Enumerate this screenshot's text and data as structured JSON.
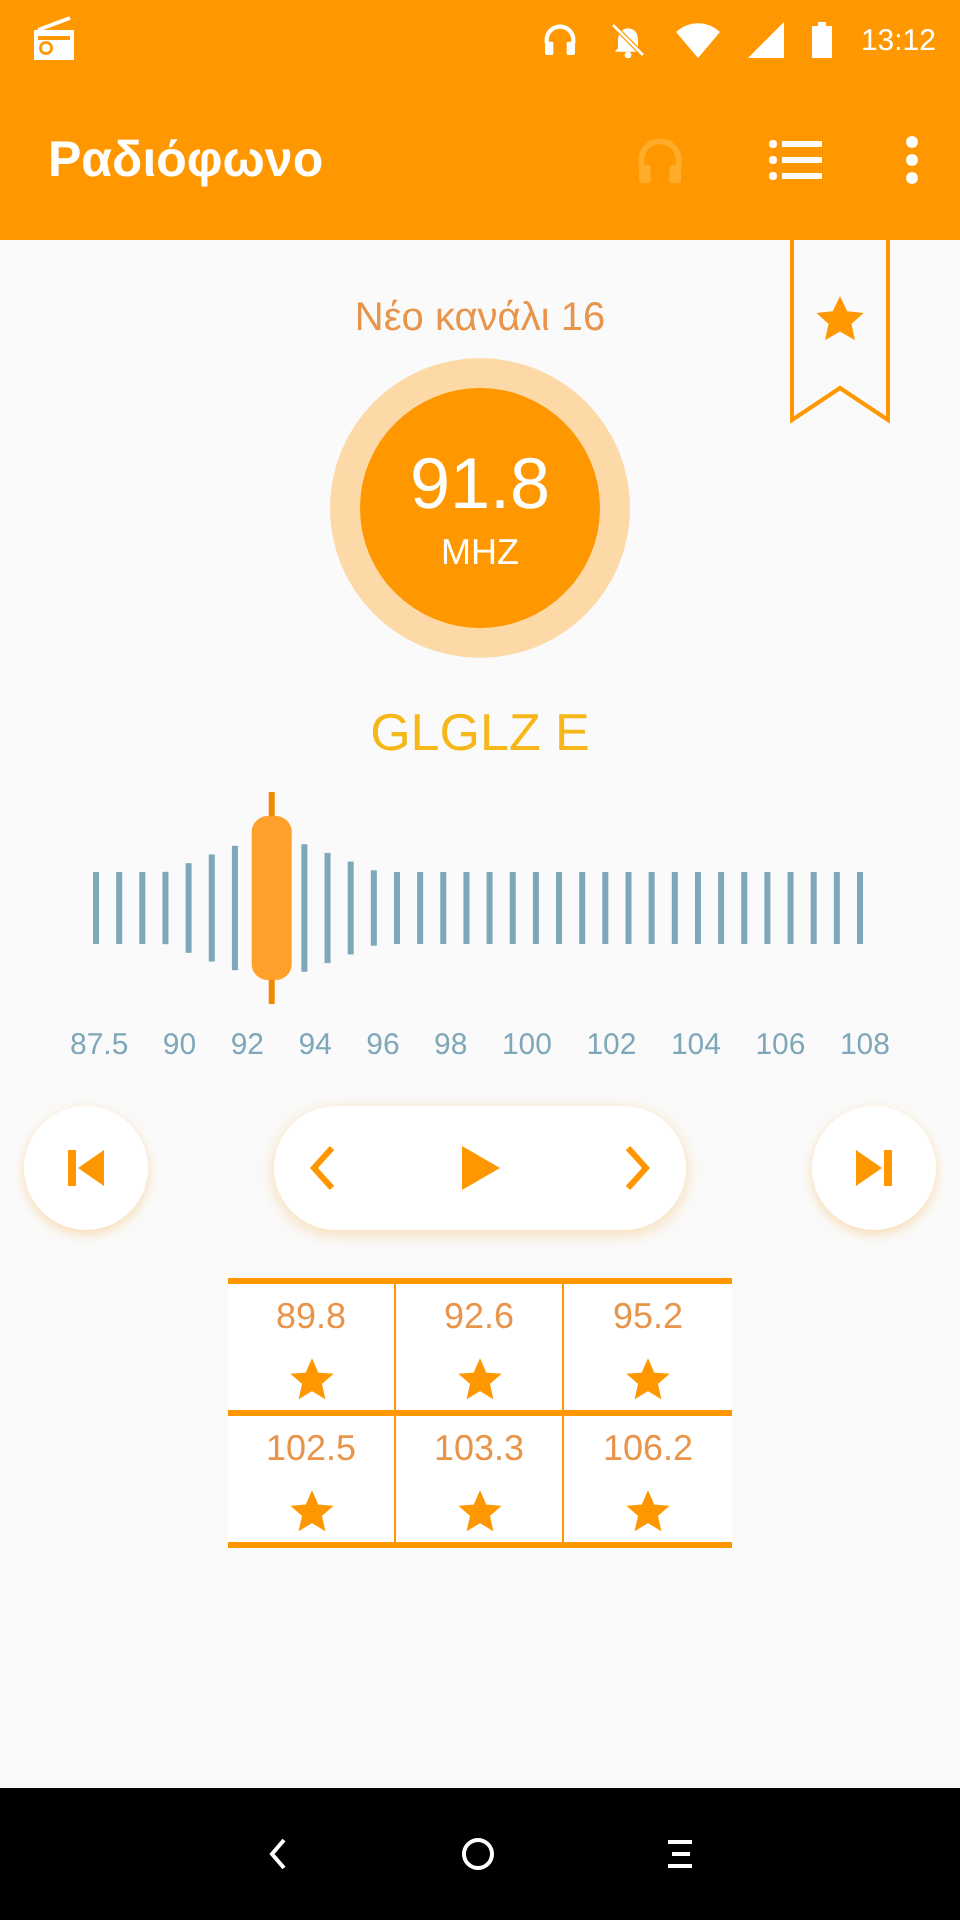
{
  "status_bar": {
    "time": "13:12"
  },
  "app_bar": {
    "title": "Ραδιόφωνο",
    "headphones_enabled": false
  },
  "station": {
    "name": "Νέο κανάλι 16",
    "frequency": "91.8",
    "unit": "MHZ",
    "rds": "GLGLZ E",
    "favorite": true
  },
  "tuner": {
    "level": 0.23,
    "scale": [
      "87.5",
      "90",
      "92",
      "94",
      "96",
      "98",
      "100",
      "102",
      "104",
      "106",
      "108"
    ]
  },
  "presets": [
    {
      "frequency": "89.8",
      "starred": true
    },
    {
      "frequency": "92.6",
      "starred": true
    },
    {
      "frequency": "95.2",
      "starred": true
    },
    {
      "frequency": "102.5",
      "starred": true
    },
    {
      "frequency": "103.3",
      "starred": true
    },
    {
      "frequency": "106.2",
      "starred": true
    }
  ]
}
